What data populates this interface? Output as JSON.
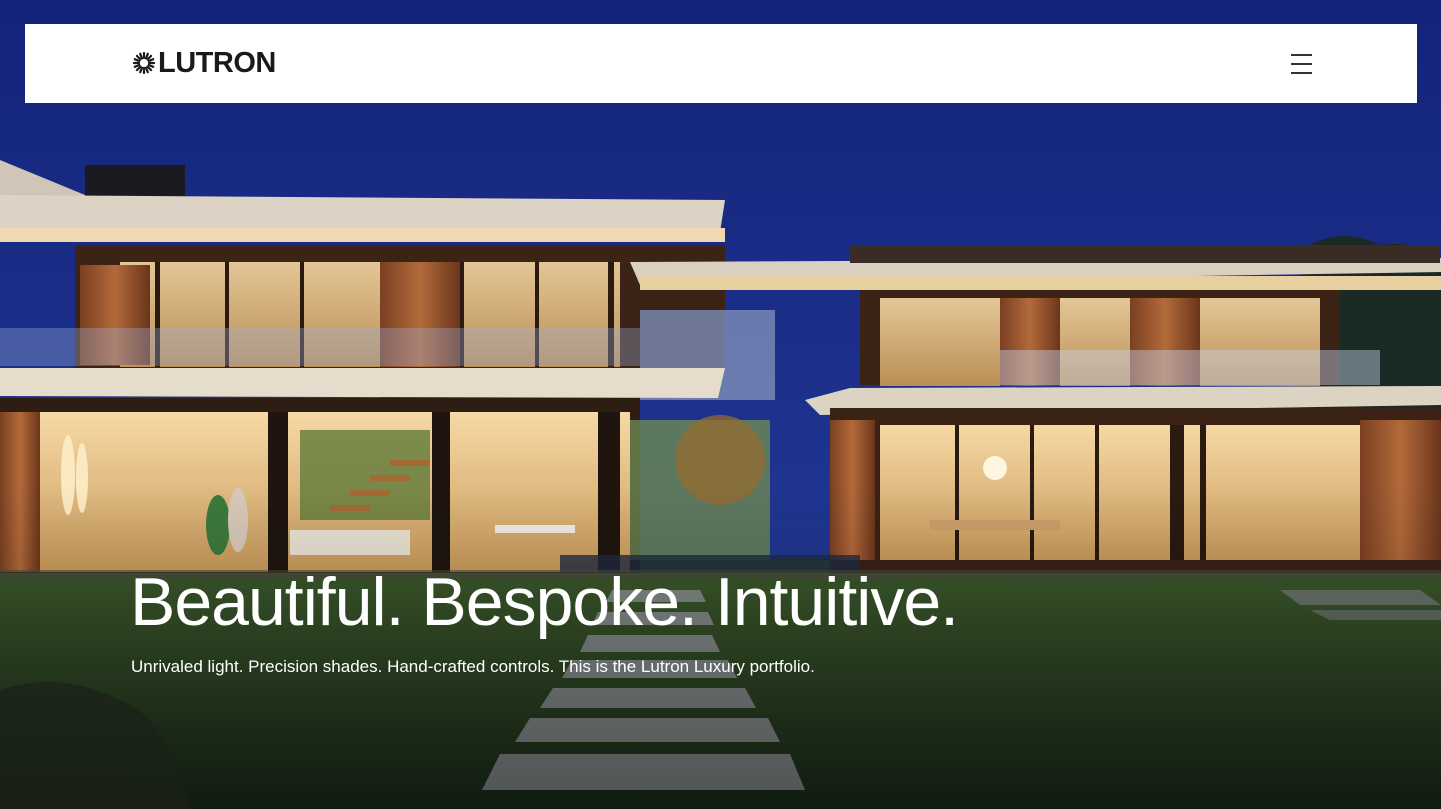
{
  "header": {
    "logo_text": "LUTRON",
    "logo_icon": "lutron-sunburst-icon",
    "menu_icon": "hamburger-menu-icon"
  },
  "hero": {
    "image": "modern-house-at-dusk",
    "headline": "Beautiful. Bespoke. Intuitive.",
    "subheadline": "Unrivaled light. Precision shades. Hand-crafted controls. This is the Lutron Luxury portfolio."
  },
  "colors": {
    "sky": "#1c2f8a",
    "lawn": "#2f4a26",
    "warm_light": "#f2c27a",
    "header_bg": "#ffffff",
    "text_dark": "#1a1a1a",
    "text_light": "#ffffff"
  }
}
